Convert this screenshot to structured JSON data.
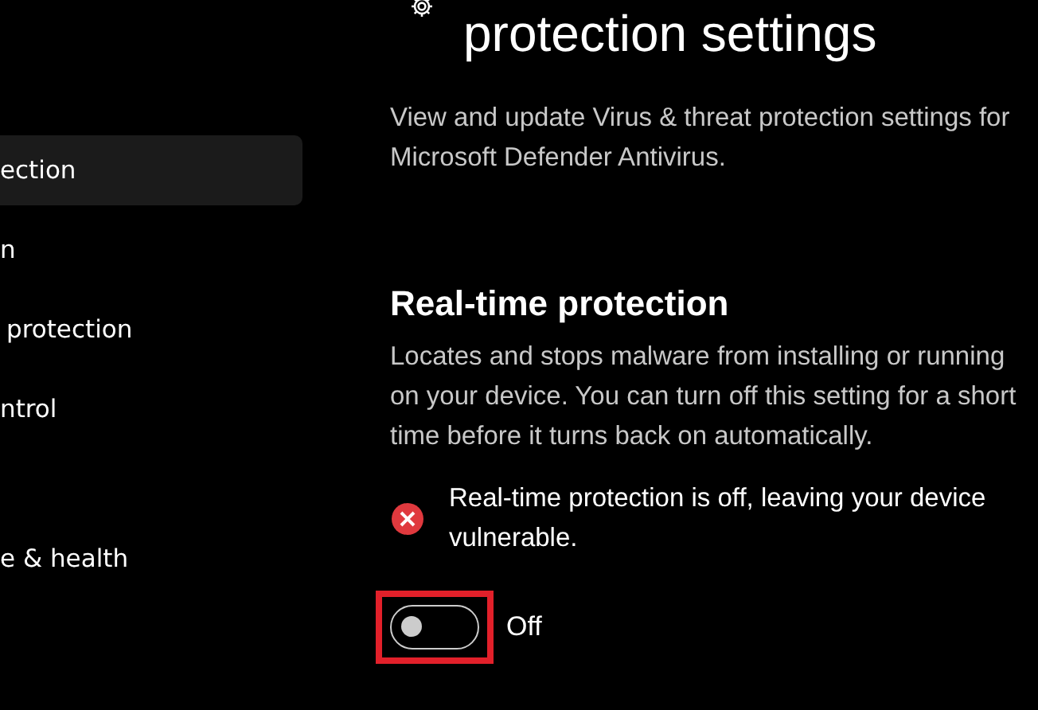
{
  "sidebar": {
    "items": [
      {
        "label": "ection",
        "selected": true
      },
      {
        "label": "n",
        "selected": false
      },
      {
        "label": "protection",
        "selected": false
      },
      {
        "label": "ntrol",
        "selected": false
      },
      {
        "label": "e & health",
        "selected": false
      }
    ]
  },
  "page": {
    "title": "protection settings",
    "description": "View and update Virus & threat protection settings for Microsoft Defender Antivirus."
  },
  "section": {
    "heading": "Real-time protection",
    "description": "Locates and stops malware from installing or running on your device. You can turn off this setting for a short time before it turns back on automatically.",
    "alert": "Real-time protection is off, leaving your device vulnerable.",
    "toggle": {
      "on": false,
      "label": "Off",
      "highlighted": true
    }
  }
}
